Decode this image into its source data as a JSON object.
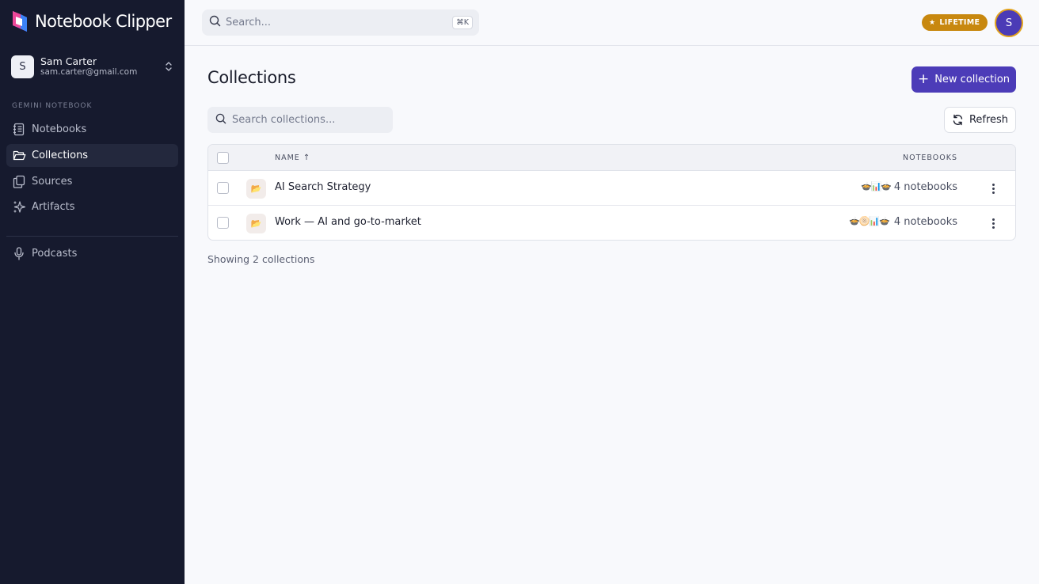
{
  "app": {
    "logo_text": "Notebook Clipper"
  },
  "user": {
    "initial": "S",
    "name": "Sam Carter",
    "email": "sam.carter@gmail.com"
  },
  "sidebar": {
    "section_label": "GEMINI NOTEBOOK",
    "items": [
      {
        "label": "Notebooks",
        "icon": "notebook-icon",
        "active": false
      },
      {
        "label": "Collections",
        "icon": "folder-icon",
        "active": true
      },
      {
        "label": "Sources",
        "icon": "files-icon",
        "active": false
      },
      {
        "label": "Artifacts",
        "icon": "sparkles-icon",
        "active": false
      }
    ],
    "secondary_items": [
      {
        "label": "Podcasts",
        "icon": "microphone-icon",
        "active": false
      }
    ]
  },
  "topbar": {
    "search_placeholder": "Search...",
    "shortcut": "⌘K",
    "badge": "LIFETIME",
    "avatar_initial": "S"
  },
  "main": {
    "title": "Collections",
    "new_button": "New collection",
    "search_placeholder": "Search collections...",
    "refresh_button": "Refresh",
    "table": {
      "columns": [
        "NAME",
        "NOTEBOOKS"
      ],
      "sort": "NAME ascending",
      "rows": [
        {
          "name": "AI Search Strategy",
          "emojis": "🍲📊🍲",
          "count": "4 notebooks"
        },
        {
          "name": "Work — AI and go-to-market",
          "emojis": "🍲🫓📊🍲",
          "count": "4 notebooks"
        }
      ]
    },
    "footer": "Showing 2 collections"
  },
  "colors": {
    "sidebar_bg": "#161a2e",
    "accent": "#4c3cb8",
    "badge": "#c8880f"
  }
}
